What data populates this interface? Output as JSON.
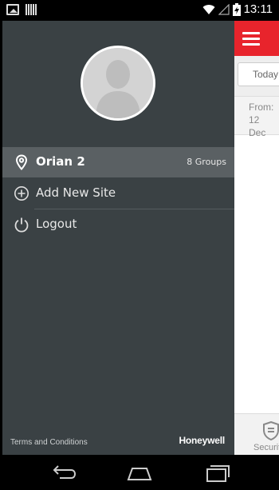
{
  "status_bar": {
    "time": "13:11",
    "icons": [
      "image-icon",
      "barcode-icon",
      "wifi-icon",
      "signal-icon",
      "battery-icon"
    ]
  },
  "drawer": {
    "avatar_icon": "user-avatar-placeholder",
    "items": [
      {
        "icon": "location-pin-icon",
        "label": "Orian 2",
        "count": "8 Groups",
        "selected": true
      },
      {
        "icon": "add-circle-icon",
        "label": "Add New Site"
      },
      {
        "icon": "power-icon",
        "label": "Logout"
      }
    ],
    "footer": {
      "terms_label": "Terms and Conditions",
      "brand": "Honeywell"
    }
  },
  "background_app": {
    "header_icon": "hamburger-menu-icon",
    "today_label": "Today",
    "from_label": "From:",
    "date_label": "12 Dec",
    "footer_tab_label": "Securit",
    "footer_tab_icon": "shield-icon"
  },
  "colors": {
    "accent": "#e8242c",
    "drawer_bg": "#3a4144",
    "selected_bg": "#5a6063"
  },
  "nav_bar": {
    "buttons": [
      "back-icon",
      "home-icon",
      "recents-icon"
    ]
  }
}
